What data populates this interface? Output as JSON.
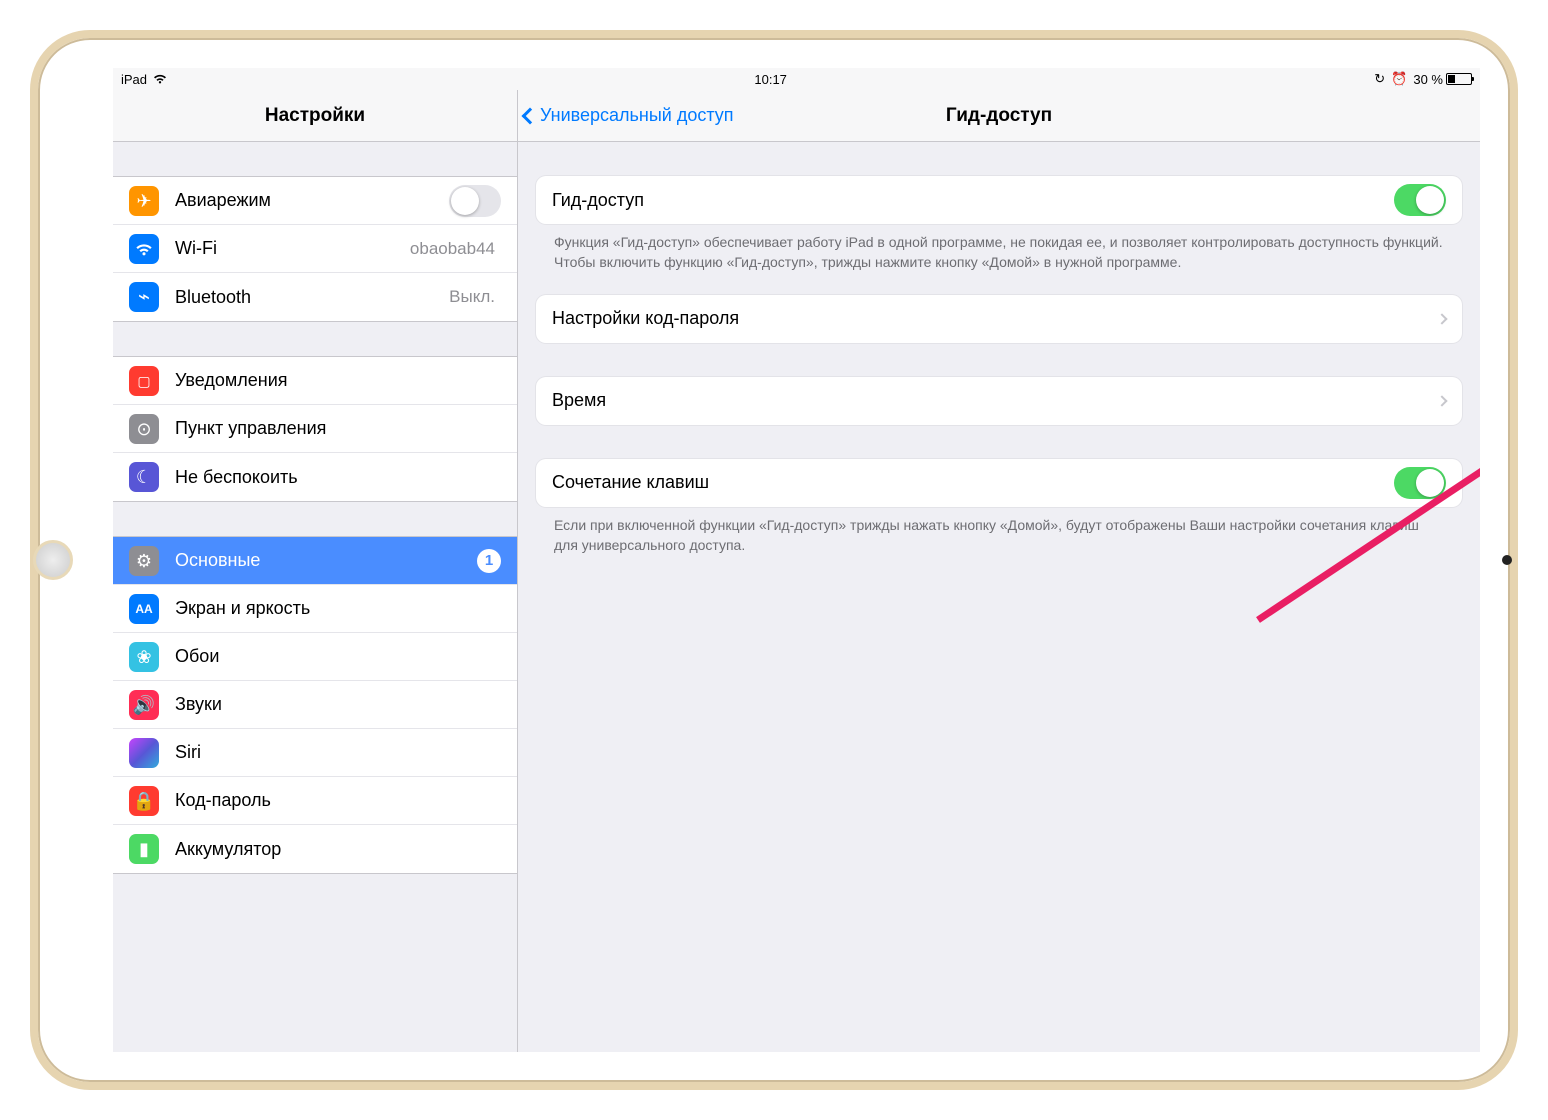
{
  "status": {
    "device": "iPad",
    "time": "10:17",
    "battery_pct": "30 %"
  },
  "sidebar": {
    "title": "Настройки",
    "g1": [
      {
        "label": "Авиарежим",
        "toggle": "off"
      },
      {
        "label": "Wi-Fi",
        "value": "obaobab44"
      },
      {
        "label": "Bluetooth",
        "value": "Выкл."
      }
    ],
    "g2": [
      {
        "label": "Уведомления"
      },
      {
        "label": "Пункт управления"
      },
      {
        "label": "Не беспокоить"
      }
    ],
    "g3": [
      {
        "label": "Основные",
        "badge": "1",
        "selected": true
      },
      {
        "label": "Экран и яркость"
      },
      {
        "label": "Обои"
      },
      {
        "label": "Звуки"
      },
      {
        "label": "Siri"
      },
      {
        "label": "Код-пароль"
      },
      {
        "label": "Аккумулятор"
      }
    ]
  },
  "detail": {
    "back": "Универсальный доступ",
    "title": "Гид-доступ",
    "guided_label": "Гид-доступ",
    "guided_foot": "Функция «Гид-доступ» обеспечивает работу iPad в одной программе, не покидая ее, и позволяет контролировать доступность функций. Чтобы включить функцию «Гид-доступ», трижды нажмите кнопку «Домой» в нужной программе.",
    "passcode_label": "Настройки код-пароля",
    "time_label": "Время",
    "shortcut_label": "Сочетание клавиш",
    "shortcut_foot": "Если при включенной функции «Гид-доступ» трижды нажать кнопку «Домой», будут отображены Ваши настройки сочетания клавиш для универсального доступа."
  }
}
